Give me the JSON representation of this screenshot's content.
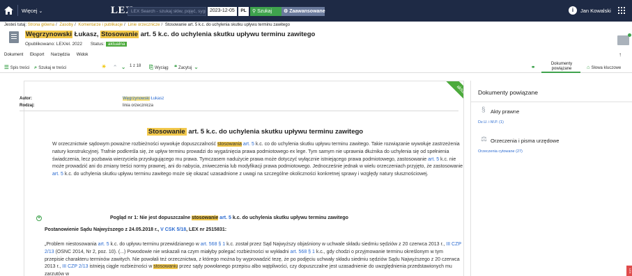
{
  "topbar": {
    "more_label": "Więcej",
    "logo": "LEX",
    "search_placeholder": "LEX Search - szukaj słów, pojęć, sygnatur...",
    "date": "2023-12-05",
    "lang": "PL",
    "search_button": "Szukaj",
    "advanced_button": "Zaawansowane",
    "user_name": "Jan Kowalski"
  },
  "breadcrumb": {
    "prefix": "Jesteś tutaj:",
    "items": [
      "Strona główna",
      "Zasoby",
      "Komentarze i publikacje",
      "Linie orzecznicze"
    ],
    "current": "Stosowanie art. 5 k.c. do uchylenia skutku upływu terminu zawitego"
  },
  "document": {
    "title_author_hl": "Węgrzynowski",
    "title_author_rest": "Łukasz,",
    "title_hl": "Stosowanie",
    "title_rest": "art. 5 k.c. do uchylenia skutku upływu terminu zawitego",
    "published_label": "Opublikowano: LEX/el. 2022",
    "status_label": "Status:",
    "status_value": "aktualna"
  },
  "menutabs": [
    "Dokument",
    "Eksport",
    "Narzędzia",
    "Widok"
  ],
  "toolbar": {
    "toc": "Spis treści",
    "search_in": "Szukaj w treści",
    "counter": "1 z 18",
    "extract": "Wyciąg",
    "cite": "Zacytuj",
    "related_docs": "Dokumenty powiązane",
    "keywords": "Słowa kluczowe"
  },
  "panel": {
    "ribbon": "aktualna",
    "author_label": "Autor:",
    "author_hl": "Węgrzynowski",
    "author_rest": "Łukasz",
    "type_label": "Rodzaj:",
    "type_value": "linia orzecznicza",
    "heading_hl": "Stosowanie",
    "heading_rest": "art. 5 k.c. do uchylenia skutku upływu terminu zawitego",
    "abstract": {
      "p1": "W orzecznictwie sądowym poważne rozbieżności wywołuje dopuszczalność ",
      "hl1": "stosowania",
      "lk1": "art. 5",
      "p2": " k.c. co do uchylenia skutku upływu terminu zawitego. Takie rozwiązanie wywołuje zastrzeżenia natury konstrukcyjnej. Trafnie podkreśla się, że upływ terminu prowadzi do wygaśnięcia prawa podmiotowego ex lege. Tym samym nie uprawnia dłużnika do uchylenia się od spełnienia świadczenia, lecz pozbawia wierzyciela przysługującego mu prawa. Tymczasem nadużycie prawa może dotyczyć wyłącznie istniejącego prawa podmiotowego, zastosowanie ",
      "lk2": "art. 5",
      "p3": " k.c. nie może prowadzić ani do zmiany treści normy prawnej, ani do nabycia, zniweczenia lub modyfikacji prawa podmiotowego. Jednocześnie jednak w wielu orzeczeniach przyjęto, że zastosowanie ",
      "lk3": "art. 5",
      "p4": " k.c. do uchylenia skutku upływu terminu zawitego może się okazać uzasadnione z uwagi na szczególne okoliczności konkretnej sprawy i względy natury słusznościowej."
    },
    "view_prefix": "Pogląd nr 1: Nie jest dopuszczalne",
    "view_hl": "stosowanie",
    "view_lk": "art. 5",
    "view_rest": "k.c. do uchylenia skutku upływu terminu zawitego",
    "ruling_prefix": "Postanowienie Sądu Najwyższego z 24.05.2018 r.,",
    "ruling_lk": "V CSK 5/18",
    "ruling_rest": ", LEX nr 2515831:",
    "quote": {
      "q1": "„Problem niestosowania ",
      "l1": "art. 5",
      "q2": " k.c. do upływu terminu przewidzianego w ",
      "l2": "art. 568 § 1",
      "q3": " k.c. został przez Sąd Najwyższy objaśniony w uchwale składu siedmiu sędziów z 20 czerwca 2013 r., ",
      "l3": "III CZP 2/13",
      "q4": " (OSNC 2014, Nr 2, poz. 10). (...) Powodowie nie wskazali na czym miałyby polegać rozbieżności w wykładni ",
      "l4": "art. 568 § 1",
      "q5": " k.c., gdy chodzi o przyjmowanie terminu określonym w tym przepisie charakteru terminów zawitych. Nie powołali też orzecznictwa, z którego można by wyprowadzić tezę, że po podjęciu uchwały składu siedmiu sędziów Sądu Najwyższego z 20 czerwca 2013 r., ",
      "l5": "III CZP 2/13",
      "q6": " istnieją ciągle rozbieżności w ",
      "h1": "stosowaniu",
      "q7": " przez sądy powołanego przepisu albo wątpliwości, czy dopuszczalne jest uzasadnienie do uwzględnienia przedstawionych mu zarzutów w"
    }
  },
  "sidepanel": {
    "title": "Dokumenty powiązane",
    "sec1_title": "Akty prawne",
    "sec1_link": "Dz.U. i M.P. (1)",
    "sec2_title": "Orzeczenia i pisma urzędowe",
    "sec2_link": "Orzeczenia cytowane (27)"
  },
  "sidetab": "LEX"
}
